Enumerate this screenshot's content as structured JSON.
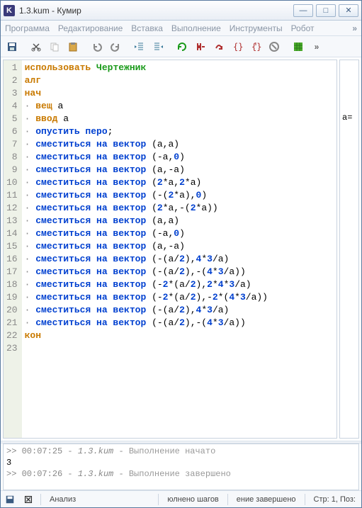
{
  "window": {
    "icon_letter": "K",
    "title": "1.3.kum - Кумир"
  },
  "menu": {
    "program": "Программа",
    "edit": "Редактирование",
    "insert": "Вставка",
    "run": "Выполнение",
    "tools": "Инструменты",
    "robot": "Робот",
    "overflow": "»"
  },
  "toolbar_overflow": "»",
  "sidepane": {
    "label": "a="
  },
  "code": {
    "lines": [
      {
        "n": 1,
        "tokens": [
          [
            "kw-orange",
            "использовать"
          ],
          [
            "sp",
            " "
          ],
          [
            "kw-green",
            "Чертежник"
          ]
        ]
      },
      {
        "n": 2,
        "tokens": [
          [
            "kw-orange",
            "алг"
          ]
        ]
      },
      {
        "n": 3,
        "tokens": [
          [
            "kw-orange",
            "нач"
          ]
        ]
      },
      {
        "n": 4,
        "tokens": [
          [
            "dot",
            "· "
          ],
          [
            "kw-orange",
            "вещ"
          ],
          [
            "sp",
            " "
          ],
          [
            "var",
            "a"
          ]
        ]
      },
      {
        "n": 5,
        "tokens": [
          [
            "dot",
            "· "
          ],
          [
            "kw-orange",
            "ввод"
          ],
          [
            "sp",
            " "
          ],
          [
            "var",
            "a"
          ]
        ]
      },
      {
        "n": 6,
        "tokens": [
          [
            "dot",
            "· "
          ],
          [
            "kw-blue",
            "опустить перо"
          ],
          [
            "var",
            ";"
          ]
        ]
      },
      {
        "n": 7,
        "tokens": [
          [
            "dot",
            "· "
          ],
          [
            "kw-blue",
            "сместиться на вектор"
          ],
          [
            "sp",
            " "
          ],
          [
            "var",
            "(a,a)"
          ]
        ]
      },
      {
        "n": 8,
        "tokens": [
          [
            "dot",
            "· "
          ],
          [
            "kw-blue",
            "сместиться на вектор"
          ],
          [
            "sp",
            " "
          ],
          [
            "var",
            "(-a,"
          ],
          [
            "num",
            "0"
          ],
          [
            "var",
            ")"
          ]
        ]
      },
      {
        "n": 9,
        "tokens": [
          [
            "dot",
            "· "
          ],
          [
            "kw-blue",
            "сместиться на вектор"
          ],
          [
            "sp",
            " "
          ],
          [
            "var",
            "(a,-a)"
          ]
        ]
      },
      {
        "n": 10,
        "tokens": [
          [
            "dot",
            "· "
          ],
          [
            "kw-blue",
            "сместиться на вектор"
          ],
          [
            "sp",
            " "
          ],
          [
            "var",
            "("
          ],
          [
            "num",
            "2"
          ],
          [
            "var",
            "*a,"
          ],
          [
            "num",
            "2"
          ],
          [
            "var",
            "*a)"
          ]
        ]
      },
      {
        "n": 11,
        "tokens": [
          [
            "dot",
            "· "
          ],
          [
            "kw-blue",
            "сместиться на вектор"
          ],
          [
            "sp",
            " "
          ],
          [
            "var",
            "(-("
          ],
          [
            "num",
            "2"
          ],
          [
            "var",
            "*a),"
          ],
          [
            "num",
            "0"
          ],
          [
            "var",
            ")"
          ]
        ]
      },
      {
        "n": 12,
        "tokens": [
          [
            "dot",
            "· "
          ],
          [
            "kw-blue",
            "сместиться на вектор"
          ],
          [
            "sp",
            " "
          ],
          [
            "var",
            "("
          ],
          [
            "num",
            "2"
          ],
          [
            "var",
            "*a,-("
          ],
          [
            "num",
            "2"
          ],
          [
            "var",
            "*a))"
          ]
        ]
      },
      {
        "n": 13,
        "tokens": [
          [
            "dot",
            "· "
          ],
          [
            "kw-blue",
            "сместиться на вектор"
          ],
          [
            "sp",
            " "
          ],
          [
            "var",
            "(a,a)"
          ]
        ]
      },
      {
        "n": 14,
        "tokens": [
          [
            "dot",
            "· "
          ],
          [
            "kw-blue",
            "сместиться на вектор"
          ],
          [
            "sp",
            " "
          ],
          [
            "var",
            "(-a,"
          ],
          [
            "num",
            "0"
          ],
          [
            "var",
            ")"
          ]
        ]
      },
      {
        "n": 15,
        "tokens": [
          [
            "dot",
            "· "
          ],
          [
            "kw-blue",
            "сместиться на вектор"
          ],
          [
            "sp",
            " "
          ],
          [
            "var",
            "(a,-a)"
          ]
        ]
      },
      {
        "n": 16,
        "tokens": [
          [
            "dot",
            "· "
          ],
          [
            "kw-blue",
            "сместиться на вектор"
          ],
          [
            "sp",
            " "
          ],
          [
            "var",
            "(-(a/"
          ],
          [
            "num",
            "2"
          ],
          [
            "var",
            "),"
          ],
          [
            "num",
            "4"
          ],
          [
            "var",
            "*"
          ],
          [
            "num",
            "3"
          ],
          [
            "var",
            "/a)"
          ]
        ]
      },
      {
        "n": 17,
        "tokens": [
          [
            "dot",
            "· "
          ],
          [
            "kw-blue",
            "сместиться на вектор"
          ],
          [
            "sp",
            " "
          ],
          [
            "var",
            "(-(a/"
          ],
          [
            "num",
            "2"
          ],
          [
            "var",
            "),-("
          ],
          [
            "num",
            "4"
          ],
          [
            "var",
            "*"
          ],
          [
            "num",
            "3"
          ],
          [
            "var",
            "/a))"
          ]
        ]
      },
      {
        "n": 18,
        "tokens": [
          [
            "dot",
            "· "
          ],
          [
            "kw-blue",
            "сместиться на вектор"
          ],
          [
            "sp",
            " "
          ],
          [
            "var",
            "(-"
          ],
          [
            "num",
            "2"
          ],
          [
            "var",
            "*(a/"
          ],
          [
            "num",
            "2"
          ],
          [
            "var",
            "),"
          ],
          [
            "num",
            "2"
          ],
          [
            "var",
            "*"
          ],
          [
            "num",
            "4"
          ],
          [
            "var",
            "*"
          ],
          [
            "num",
            "3"
          ],
          [
            "var",
            "/a)"
          ]
        ]
      },
      {
        "n": 19,
        "tokens": [
          [
            "dot",
            "· "
          ],
          [
            "kw-blue",
            "сместиться на вектор"
          ],
          [
            "sp",
            " "
          ],
          [
            "var",
            "(-"
          ],
          [
            "num",
            "2"
          ],
          [
            "var",
            "*(a/"
          ],
          [
            "num",
            "2"
          ],
          [
            "var",
            "),-"
          ],
          [
            "num",
            "2"
          ],
          [
            "var",
            "*("
          ],
          [
            "num",
            "4"
          ],
          [
            "var",
            "*"
          ],
          [
            "num",
            "3"
          ],
          [
            "var",
            "/a))"
          ]
        ]
      },
      {
        "n": 20,
        "tokens": [
          [
            "dot",
            "· "
          ],
          [
            "kw-blue",
            "сместиться на вектор"
          ],
          [
            "sp",
            " "
          ],
          [
            "var",
            "(-(a/"
          ],
          [
            "num",
            "2"
          ],
          [
            "var",
            "),"
          ],
          [
            "num",
            "4"
          ],
          [
            "var",
            "*"
          ],
          [
            "num",
            "3"
          ],
          [
            "var",
            "/a)"
          ]
        ]
      },
      {
        "n": 21,
        "tokens": [
          [
            "dot",
            "· "
          ],
          [
            "kw-blue",
            "сместиться на вектор"
          ],
          [
            "sp",
            " "
          ],
          [
            "var",
            "(-(a/"
          ],
          [
            "num",
            "2"
          ],
          [
            "var",
            "),-("
          ],
          [
            "num",
            "4"
          ],
          [
            "var",
            "*"
          ],
          [
            "num",
            "3"
          ],
          [
            "var",
            "/a))"
          ]
        ]
      },
      {
        "n": 22,
        "tokens": [
          [
            "kw-orange",
            "кон"
          ]
        ]
      },
      {
        "n": 23,
        "tokens": []
      }
    ]
  },
  "console": {
    "lines": [
      {
        "prefix": ">> ",
        "ts": "00:07:25",
        "sep1": " - ",
        "fn": "1.3.kum",
        "sep2": " - ",
        "msg": "Выполнение начато"
      },
      {
        "raw": "3"
      },
      {
        "prefix": ">> ",
        "ts": "00:07:26",
        "sep1": " - ",
        "fn": "1.3.kum",
        "sep2": " - ",
        "msg": "Выполнение завершено"
      }
    ]
  },
  "status": {
    "analysis": "Анализ",
    "steps": "юлнено шагов",
    "state": "ение завершено",
    "pos": "Стр: 1, Поз:"
  }
}
